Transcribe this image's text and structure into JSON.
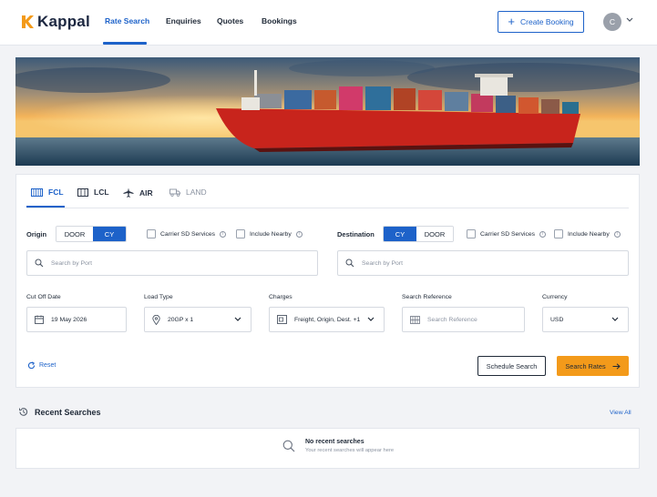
{
  "brand": {
    "name": "Kappal",
    "accent": "#1d62c9",
    "logo_color": "#f39a1a"
  },
  "nav": {
    "items": [
      {
        "label": "Rate Search",
        "active": true
      },
      {
        "label": "Enquiries",
        "active": false
      },
      {
        "label": "Quotes",
        "active": false
      },
      {
        "label": "Bookings",
        "active": false
      }
    ],
    "create_booking": "Create Booking",
    "avatar_initial": "C"
  },
  "hero": {
    "image": "container-ship-at-sunset"
  },
  "modes": [
    {
      "label": "FCL",
      "icon": "container-icon",
      "active": true
    },
    {
      "label": "LCL",
      "icon": "pallet-icon",
      "active": false
    },
    {
      "label": "AIR",
      "icon": "plane-icon",
      "active": false
    },
    {
      "label": "LAND",
      "icon": "truck-icon",
      "active": false
    }
  ],
  "origin": {
    "label": "Origin",
    "toggle": [
      {
        "label": "DOOR",
        "selected": false
      },
      {
        "label": "CY",
        "selected": true
      }
    ],
    "carrier_sd": "Carrier SD Services",
    "include_nearby": "Include Nearby",
    "placeholder": "Search by Port"
  },
  "destination": {
    "label": "Destination",
    "toggle": [
      {
        "label": "CY",
        "selected": true
      },
      {
        "label": "DOOR",
        "selected": false
      }
    ],
    "carrier_sd": "Carrier SD Services",
    "include_nearby": "Include Nearby",
    "placeholder": "Search by Port"
  },
  "fields": {
    "cutoff": {
      "label": "Cut Off Date",
      "value": "19 May 2026"
    },
    "load": {
      "label": "Load Type",
      "value": "20GP x 1"
    },
    "charges": {
      "label": "Charges",
      "value": "Freight, Origin, Dest. +1"
    },
    "reference": {
      "label": "Search Reference",
      "placeholder": "Search Reference"
    },
    "currency": {
      "label": "Currency",
      "value": "USD"
    }
  },
  "actions": {
    "reset": "Reset",
    "schedule": "Schedule Search",
    "search_rates": "Search Rates"
  },
  "recent": {
    "title": "Recent Searches",
    "view_all": "View All",
    "empty_title": "No recent searches",
    "empty_subtitle": "Your recent searches will appear here"
  }
}
